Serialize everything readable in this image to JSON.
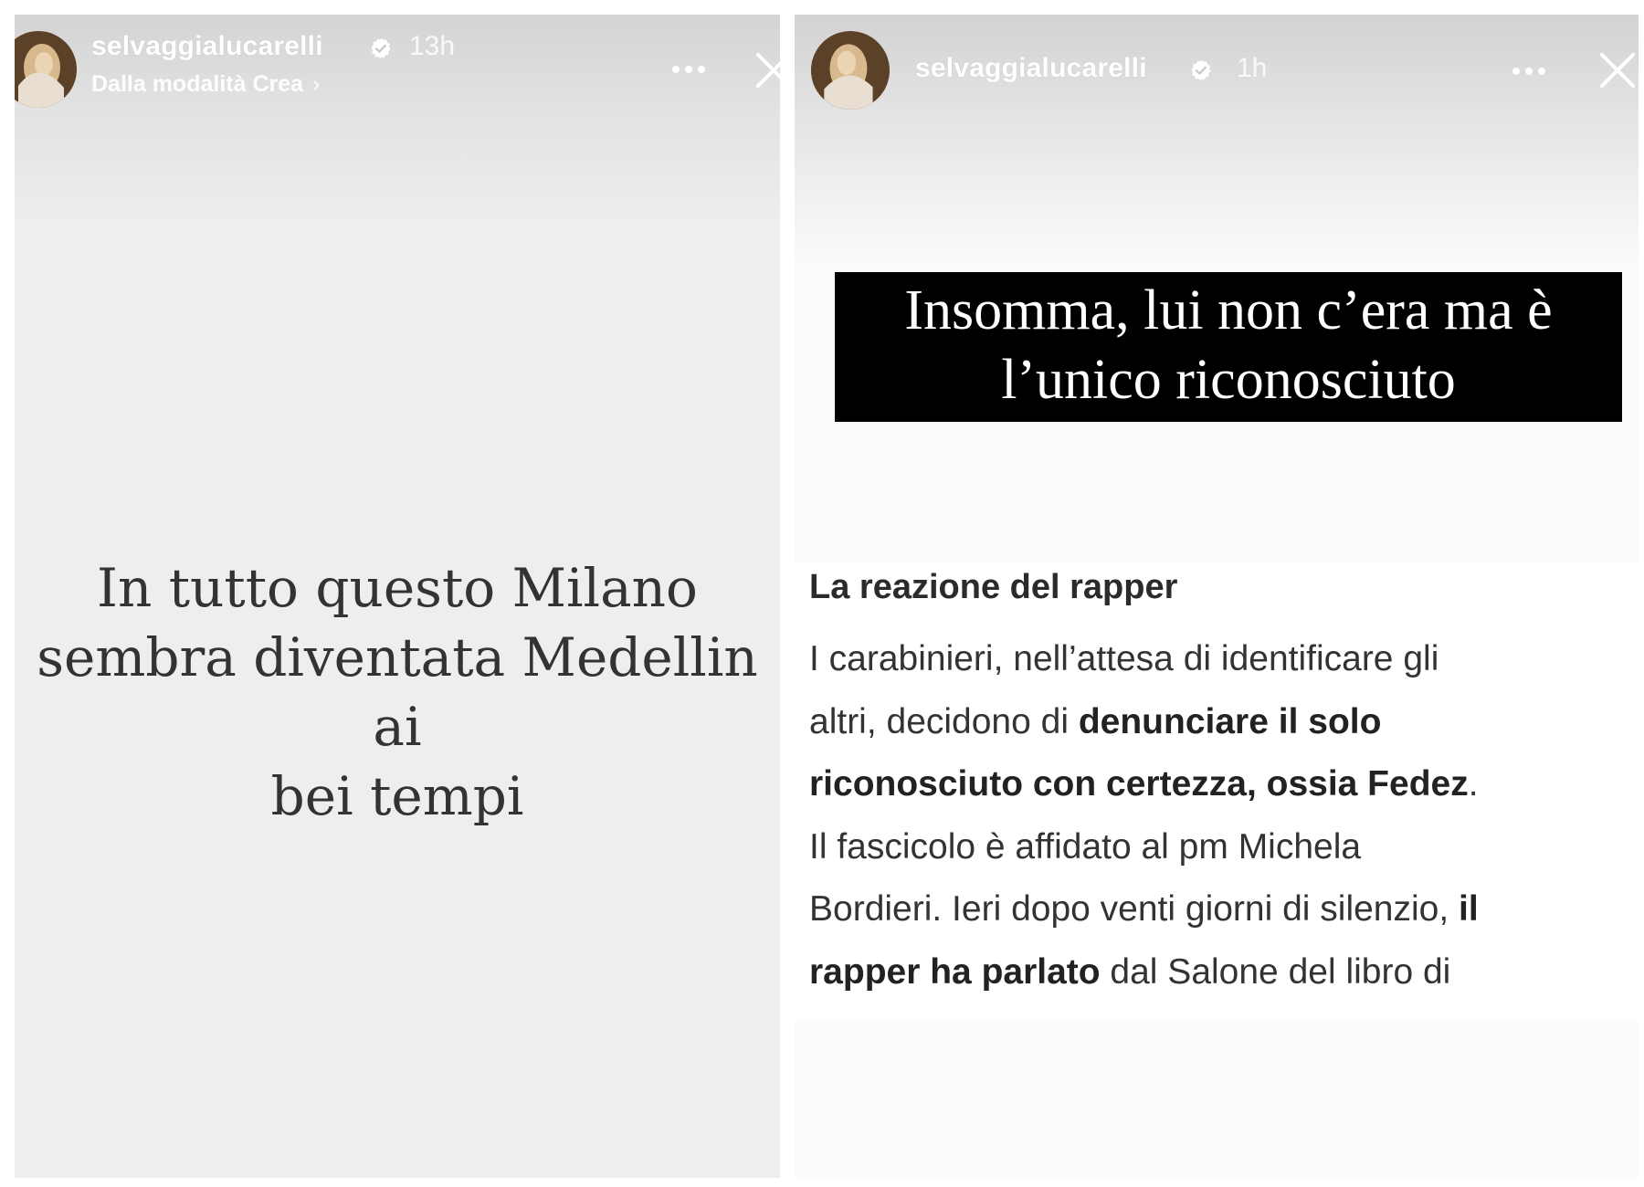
{
  "stories": [
    {
      "user": {
        "username": "selvaggialucarelli",
        "verified": true,
        "time": "13h",
        "subtitle": "Dalla modalità Crea"
      },
      "text_lines": [
        "In tutto questo Milano",
        "sembra diventata Medellin ai",
        "bei tempi"
      ]
    },
    {
      "user": {
        "username": "selvaggialucarelli",
        "verified": true,
        "time": "1h"
      },
      "banner_lines": [
        "Insomma, lui non c’era ma è",
        "l’unico riconosciuto"
      ],
      "article": {
        "heading": "La reazione del rapper",
        "lines": [
          [
            {
              "t": "I carabinieri, nell’attesa di identificare gli",
              "b": false
            }
          ],
          [
            {
              "t": "altri, decidono di ",
              "b": false
            },
            {
              "t": "denunciare il solo",
              "b": true
            }
          ],
          [
            {
              "t": "riconosciuto con certezza, ossia Fedez",
              "b": true
            },
            {
              "t": ".",
              "b": false
            }
          ],
          [
            {
              "t": "Il fascicolo è affidato al pm Michela",
              "b": false
            }
          ],
          [
            {
              "t": "Bordieri. Ieri dopo venti giorni di silenzio, ",
              "b": false
            },
            {
              "t": "il",
              "b": true
            }
          ],
          [
            {
              "t": "rapper ha parlato",
              "b": true
            },
            {
              "t": " dal Salone del libro di",
              "b": false
            }
          ]
        ]
      }
    }
  ],
  "icons": {
    "verified": "verified-badge-icon",
    "more": "more-options-icon",
    "close": "close-icon",
    "chevron": "chevron-right-icon"
  }
}
